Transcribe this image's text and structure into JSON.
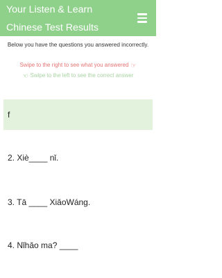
{
  "header": {
    "title": "Your Listen & Learn Chinese Test Results",
    "menu_icon": "hamburger-menu-icon",
    "background_color": "#8fd18a"
  },
  "intro": {
    "text": "Below you have the questions you answered incorrectly."
  },
  "hints": {
    "swipe_right": "Swipe to the right to see what you answered",
    "swipe_right_icon": "hand-pointing-right-icon",
    "swipe_left": "Swipe to the left to see the correct answer",
    "swipe_left_icon": "hand-pointing-left-icon"
  },
  "questions": [
    {
      "text": "f",
      "highlighted": true
    },
    {
      "text": "2. Xiè____ nǐ.",
      "highlighted": false
    },
    {
      "text": "3. Tā ____ XiǎoWáng.",
      "highlighted": false
    },
    {
      "text": "4. Nǐhǎo ma? ____",
      "highlighted": false
    }
  ]
}
